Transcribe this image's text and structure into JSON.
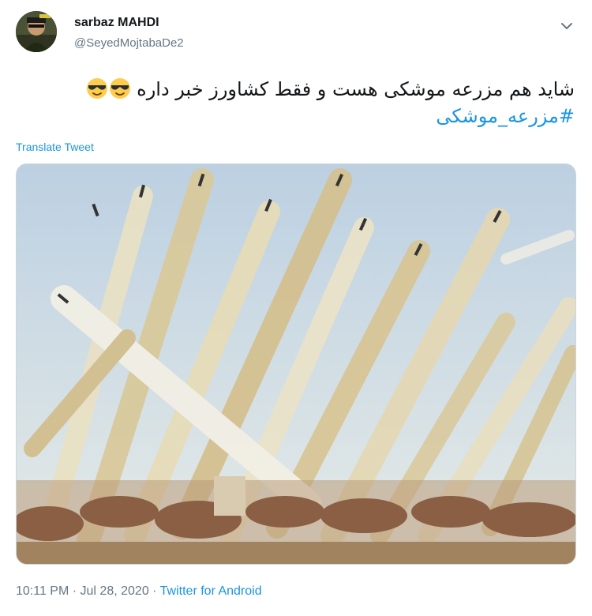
{
  "user": {
    "display_name": "sarbaz MAHDI",
    "handle": "@SeyedMojtabaDe2"
  },
  "tweet": {
    "text_line1": "شاید هم مزرعه موشکی هست و فقط کشاورز خبر داره",
    "emoji": "smiling-face-with-sunglasses-icon",
    "hashtag": "#مزرعه_موشکی",
    "translate_label": "Translate Tweet"
  },
  "meta": {
    "time": "10:11 PM",
    "date": "Jul 28, 2020",
    "separator": "·",
    "source": "Twitter for Android"
  },
  "colors": {
    "link": "#1b95e0",
    "secondary": "#657786",
    "border": "#ccd6dd"
  }
}
